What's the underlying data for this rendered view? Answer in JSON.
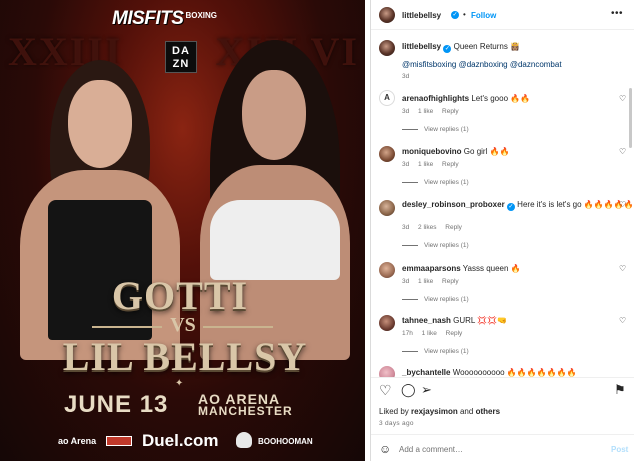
{
  "poster": {
    "brand": "MISFITS",
    "brand_sub": "BOXING",
    "roman_left": "XXIII",
    "roman_right": "XIII VI",
    "dazn_line1": "DA",
    "dazn_line2": "ZN",
    "title_top": "GOTTI",
    "title_vs": "VS",
    "title_bottom": "LIL BELLSY",
    "date": "JUNE 13",
    "venue_line1": "AO ARENA",
    "venue_line2": "MANCHESTER",
    "sparkle": "✦",
    "sponsors": [
      "ao Arena",
      "Duel.com",
      "BOOHOOMAN"
    ]
  },
  "post": {
    "owner": "littlebellsy",
    "verified_mark": "✓",
    "separator": "•",
    "follow_label": "Follow",
    "more_label": "•••",
    "caption": "Queen Returns 👸🏽",
    "caption_mentions": "@misfitsboxing @daznboxing @dazncombat",
    "caption_age": "3d"
  },
  "comments": [
    {
      "user": "arenaofhighlights",
      "text": "Let's gooo 🔥🔥",
      "age": "3d",
      "likes": "1 like",
      "reply": "Reply",
      "view_replies": "View replies (1)",
      "avatar_color": "#ffffff",
      "avatar_glyph": "A"
    },
    {
      "user": "moniquebovino",
      "text": "Go girl 🔥🔥",
      "age": "3d",
      "likes": "1 like",
      "reply": "Reply",
      "view_replies": "View replies (1)",
      "avatar_color": "#8a5a3c",
      "avatar_glyph": ""
    },
    {
      "user": "desley_robinson_proboxer",
      "text": "Here it's is let's go 🔥🔥🔥🔥🔥🔥",
      "age": "3d",
      "likes": "2 likes",
      "reply": "Reply",
      "view_replies": "View replies (1)",
      "avatar_color": "#b08060",
      "avatar_glyph": ""
    },
    {
      "user": "emmaaparsons",
      "text": "Yasss queen 🔥",
      "age": "3d",
      "likes": "1 like",
      "reply": "Reply",
      "view_replies": "View replies (1)",
      "avatar_color": "#a86f55",
      "avatar_glyph": ""
    },
    {
      "user": "tahnee_nash",
      "text": "GURL 💢💢🤜",
      "age": "17h",
      "likes": "1 like",
      "reply": "Reply",
      "view_replies": "View replies (1)",
      "avatar_color": "#6b3b30",
      "avatar_glyph": ""
    },
    {
      "user": "_bychantelle",
      "text": "Woooooooooo 🔥🔥🔥🔥🔥🔥🔥",
      "age": "",
      "likes": "",
      "reply": "",
      "view_replies": "",
      "avatar_color": "#d08a9a",
      "avatar_glyph": ""
    }
  ],
  "actions": {
    "like_icon": "♡",
    "comment_icon": "◯",
    "share_icon": "➢",
    "save_icon": "⚑",
    "liked_by_prefix": "Liked by",
    "liked_by_user": "rexjaysimon",
    "liked_by_suffix": "and",
    "liked_by_others": "others",
    "time_ago": "3 days ago",
    "emoji_icon": "☺",
    "add_comment_placeholder": "Add a comment…",
    "post_label": "Post"
  }
}
